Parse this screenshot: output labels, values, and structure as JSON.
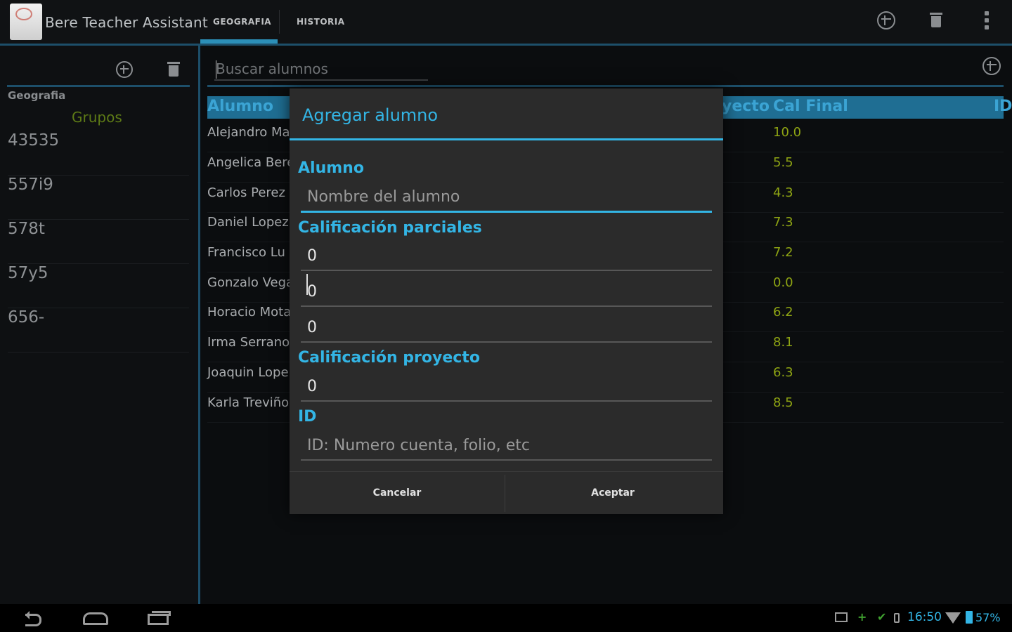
{
  "app": {
    "title": "Bere Teacher Assistant",
    "tabs": [
      {
        "label": "GEOGRAFIA",
        "selected": true
      },
      {
        "label": "HISTORIA",
        "selected": false
      }
    ]
  },
  "sidebar": {
    "subject": "Geografia",
    "groups_title": "Grupos",
    "groups": [
      "43535",
      "557i9",
      "578t",
      "57y5",
      "656-"
    ]
  },
  "search": {
    "placeholder": "Buscar alumnos"
  },
  "table": {
    "headers": {
      "student": "Alumno",
      "project": "yecto",
      "final": "Cal Final",
      "id": "ID"
    },
    "rows": [
      {
        "name": "Alejandro Ma",
        "final": "10.0"
      },
      {
        "name": "Angelica Bere",
        "final": "5.5"
      },
      {
        "name": "Carlos Perez",
        "final": "4.3"
      },
      {
        "name": "Daniel Lopez",
        "final": "7.3"
      },
      {
        "name": "Francisco Lu",
        "final": "7.2"
      },
      {
        "name": "Gonzalo Vega",
        "final": "0.0"
      },
      {
        "name": "Horacio Mota",
        "final": "6.2"
      },
      {
        "name": "Irma Serrano",
        "final": "8.1"
      },
      {
        "name": "Joaquin Lope",
        "final": "6.3"
      },
      {
        "name": "Karla Treviño",
        "final": "8.5"
      }
    ]
  },
  "dialog": {
    "title": "Agregar alumno",
    "student_label": "Alumno",
    "student_placeholder": "Nombre del alumno",
    "partials_label": "Calificación parciales",
    "partials": [
      "0",
      "0",
      "0"
    ],
    "project_label": "Calificación proyecto",
    "project_value": "0",
    "id_label": "ID",
    "id_placeholder": "ID: Numero cuenta, folio, etc",
    "cancel": "Cancelar",
    "accept": "Aceptar"
  },
  "status_bar": {
    "time": "16:50",
    "battery": "57%"
  },
  "colors": {
    "accent": "#33b5e5",
    "grade_text": "#8ea413",
    "groups_title": "#5d7a16",
    "header_bg": "#1f6e93"
  },
  "icons": [
    "add-circle-icon",
    "trash-icon",
    "overflow-menu-icon",
    "back-icon",
    "home-icon",
    "recents-icon",
    "picture-icon",
    "wifi-icon",
    "battery-icon"
  ]
}
